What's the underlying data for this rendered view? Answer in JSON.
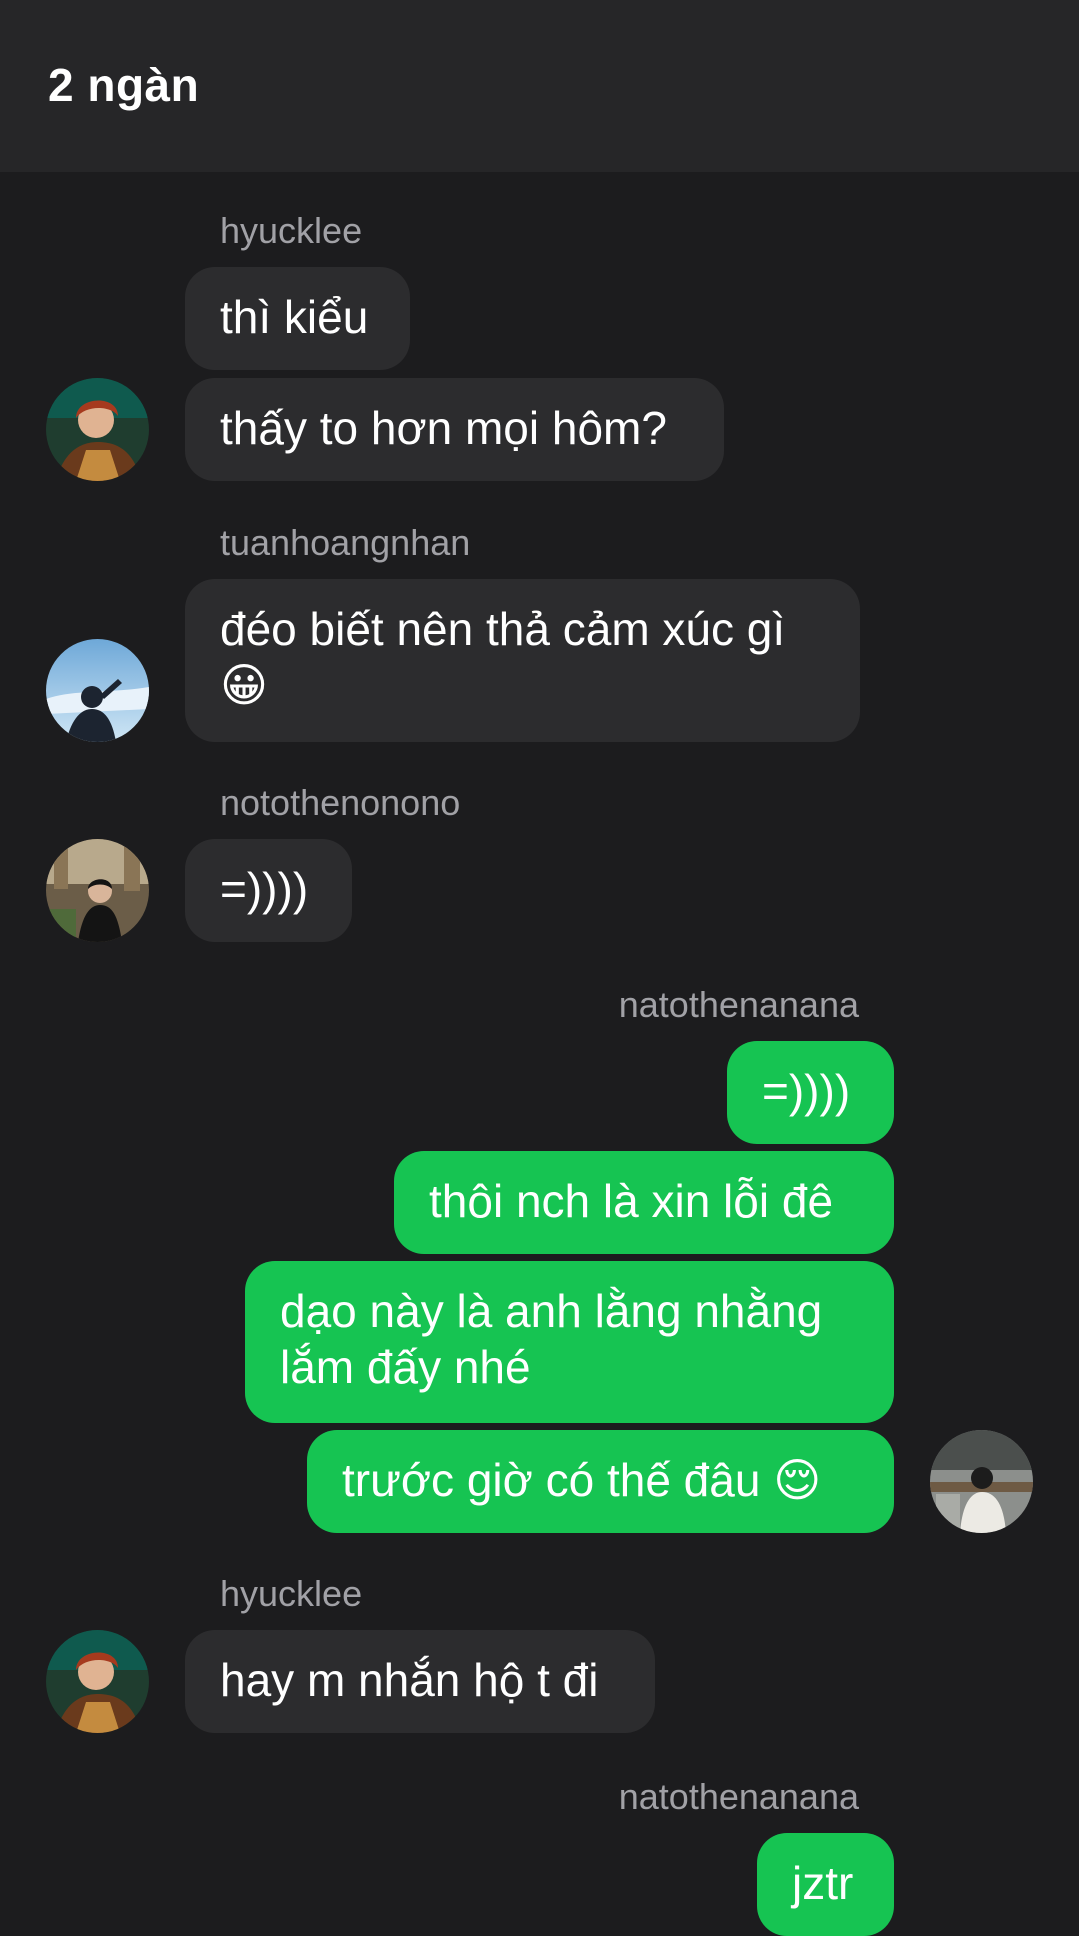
{
  "header": {
    "title": "2 ngàn"
  },
  "messages": [
    {
      "sender": "hyucklee",
      "texts": [
        "thì kiểu",
        "thấy to hơn mọi hôm?"
      ]
    },
    {
      "sender": "tuanhoangnhan",
      "text": "đéo biết nên thả cảm xúc gì",
      "emoji": "😀"
    },
    {
      "sender": "notothenonono",
      "text": "=))))"
    },
    {
      "sender": "natothenanana",
      "texts": [
        "=))))",
        "thôi nch là xin lỗi đê",
        "dạo này là anh lằng nhằng lắm đấy nhé",
        "trước giờ có thế đâu"
      ],
      "emoji": "😌"
    },
    {
      "sender": "hyucklee",
      "text": "hay m nhắn hộ t đi"
    },
    {
      "sender": "natothenanana",
      "text": "jztr"
    }
  ],
  "avatars": [
    "hyucklee-avatar",
    "tuanhoangnhan-avatar",
    "notothenonono-avatar",
    "natothenanana-avatar"
  ]
}
